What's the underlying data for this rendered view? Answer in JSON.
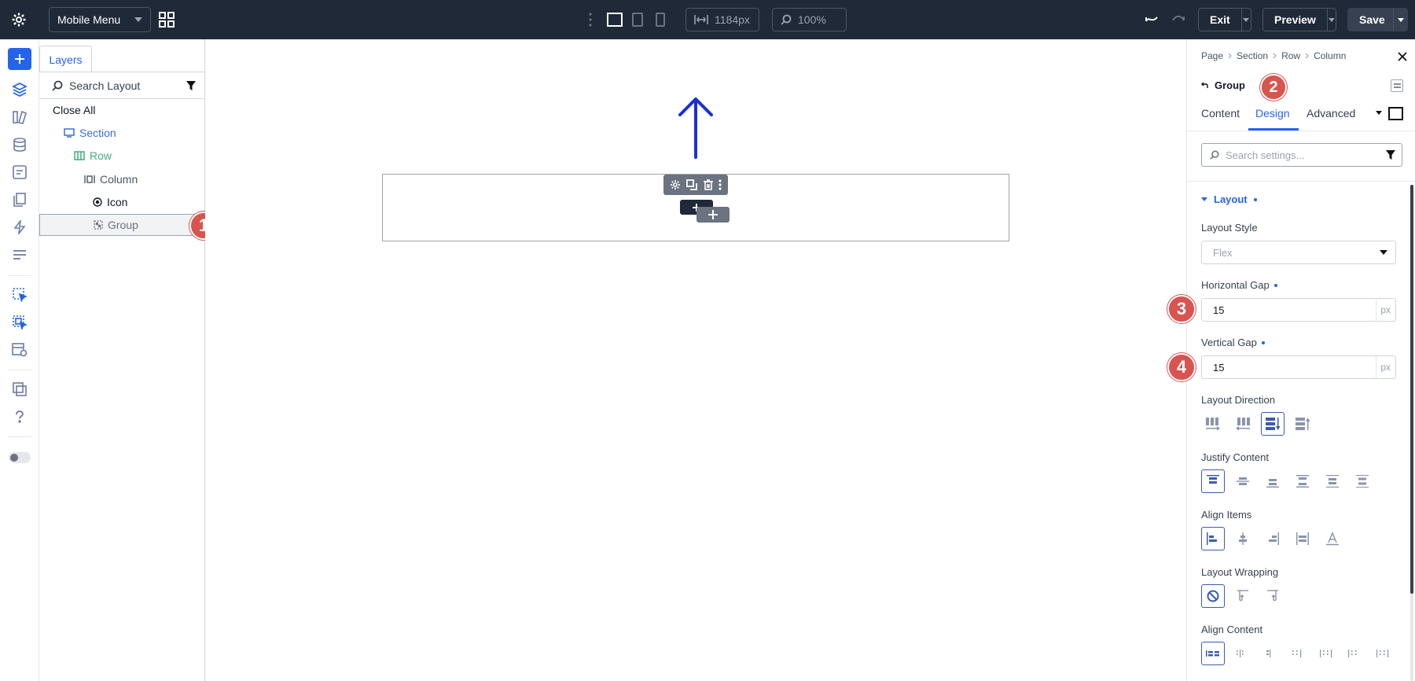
{
  "topbar": {
    "menu_select": "Mobile Menu",
    "width_value": "1184px",
    "zoom_value": "100%",
    "exit_label": "Exit",
    "preview_label": "Preview",
    "save_label": "Save"
  },
  "layers": {
    "tab_label": "Layers",
    "search_placeholder": "Search Layout",
    "close_all": "Close All",
    "tree": [
      {
        "label": "Section",
        "icon": "section-icon",
        "color": "#3b6fd6"
      },
      {
        "label": "Row",
        "icon": "row-icon",
        "color": "#3fae7c"
      },
      {
        "label": "Column",
        "icon": "column-icon",
        "color": "#4b5563"
      },
      {
        "label": "Icon",
        "icon": "circle-dot-icon",
        "color": "#111827"
      },
      {
        "label": "Group",
        "icon": "group-icon",
        "color": "#6b7280"
      }
    ]
  },
  "settings": {
    "breadcrumb": [
      "Page",
      "Section",
      "Row",
      "Column"
    ],
    "module_title": "Group",
    "tabs": [
      "Content",
      "Design",
      "Advanced"
    ],
    "active_tab": "Design",
    "search_placeholder": "Search settings...",
    "group_title": "Layout",
    "layout_style_label": "Layout Style",
    "layout_style_value": "Flex",
    "h_gap_label": "Horizontal Gap",
    "h_gap_value": "15",
    "v_gap_label": "Vertical Gap",
    "v_gap_value": "15",
    "unit": "px",
    "layout_direction_label": "Layout Direction",
    "justify_content_label": "Justify Content",
    "align_items_label": "Align Items",
    "layout_wrapping_label": "Layout Wrapping",
    "align_content_label": "Align Content"
  },
  "markers": [
    "1",
    "2",
    "3",
    "4"
  ],
  "colors": {
    "accent": "#2563eb",
    "topbar": "#1f2937",
    "marker": "#d9534f",
    "arrow": "#1a2fd8"
  }
}
